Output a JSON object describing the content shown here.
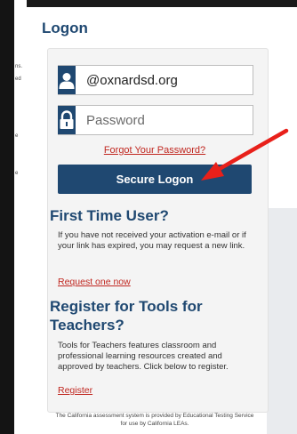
{
  "page_title": "Logon",
  "username": {
    "value": "@oxnardsd.org"
  },
  "password": {
    "placeholder": "Password"
  },
  "forgot_link": "Forgot Your Password?",
  "logon_button": "Secure Logon",
  "first_time": {
    "heading": "First Time User?",
    "text": "If you have not received your activation e-mail or if your link has expired, you may request a new link.",
    "link": "Request one now"
  },
  "tools": {
    "heading_line1": "Register for Tools for",
    "heading_line2": "Teachers?",
    "text": "Tools for Teachers features classroom and professional learning resources created and approved by teachers. Click below to register.",
    "link": "Register"
  },
  "footer": {
    "line1": "The California assessment system is provided by Educational Testing Service",
    "line2": "for use by California LEAs."
  },
  "side_fragments": [
    "ns.",
    "ed",
    "e",
    "e"
  ],
  "colors": {
    "brand": "#1f4871",
    "link": "#c0261f",
    "annotation_arrow": "#e8201a"
  },
  "icons": [
    "user-icon",
    "lock-icon",
    "red-arrow-annotation"
  ]
}
